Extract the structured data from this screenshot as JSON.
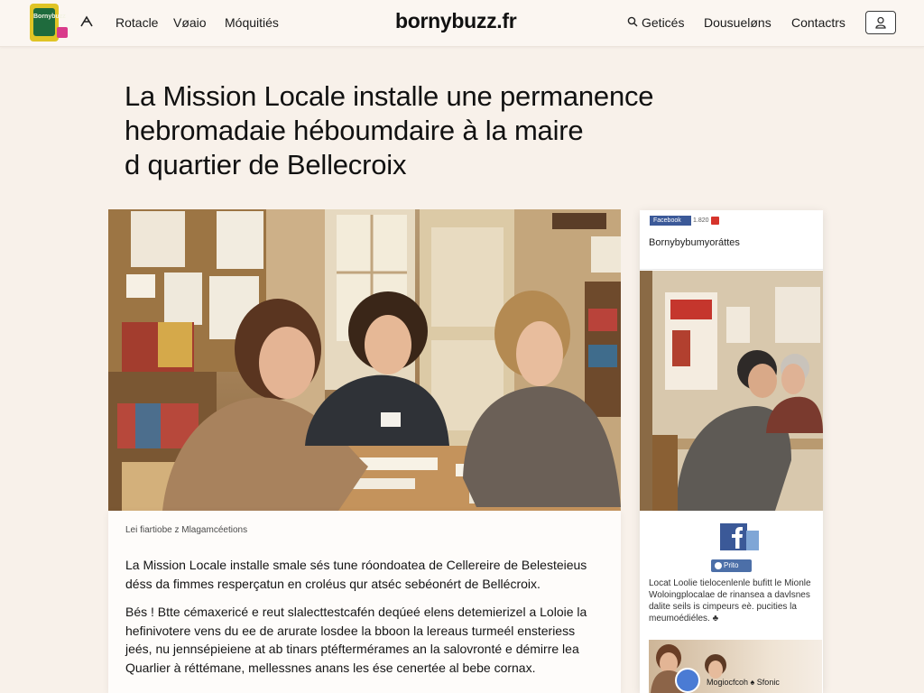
{
  "header": {
    "logo_text": "Bornybuzz",
    "nav_left": [
      "Rotacle",
      "Vøaio",
      "Móquitiés"
    ],
    "site_title": "bornybuzz.fr",
    "nav_right": [
      "Geticés",
      "Dousueløns",
      "Contactrs"
    ]
  },
  "article": {
    "title": "La Mission Locale installe une permanence hebromadaie héboumdaire à la maire d quartier de Bellecroix",
    "title_lines": [
      "La Mission Locale installe une permanence",
      "hebromadaie héboumdaire à la maire",
      "d quartier de Bellecroix"
    ],
    "caption": "Lei fiartiobe z Mlagamcéetions",
    "paragraph1": "La Mission Locale installe smale sés tune róondoatea de Cellereire de Belesteieus déss da fimmes resperçatun en croléus qur atséc sebéonért de Bellécroix.",
    "paragraph2": "Bés ! Btte cémaxericé e reut slalecttestcafén deqúeé elens detemierizel a Loloie la hefinivotere vens du ee de arurate losdee la bboon la lereaus turmeél ensteriess jeés, nu jennsépieiene at ab tinars ptéftermérames an la salovronté e démirre lea Quarlier à réttémane, mellessnes anans les ése cenertée al bebe cornax."
  },
  "sidebar": {
    "fb_badge": "Facebook",
    "count": "1.820",
    "heading": "Bornybybumyoráttes",
    "photo_button": "Prito",
    "text": "Locat Loolie tielocenlenle bufitt le Mionle Woloingplocalae de rinansea a davlsnes dalite seils is cimpeurs eè. pucities la meumoédiéles. ♣",
    "thumb_label": "Mogiocfcoh  ♠ Sfonic"
  },
  "colors": {
    "background": "#f8f1ea",
    "header_bg": "#fbf6f1",
    "logo_yellow": "#e0c425",
    "logo_green": "#1f6b3d",
    "facebook_blue": "#3b5998"
  },
  "icons": [
    "hamburger-icon",
    "search-icon",
    "user-icon",
    "facebook-icon"
  ]
}
